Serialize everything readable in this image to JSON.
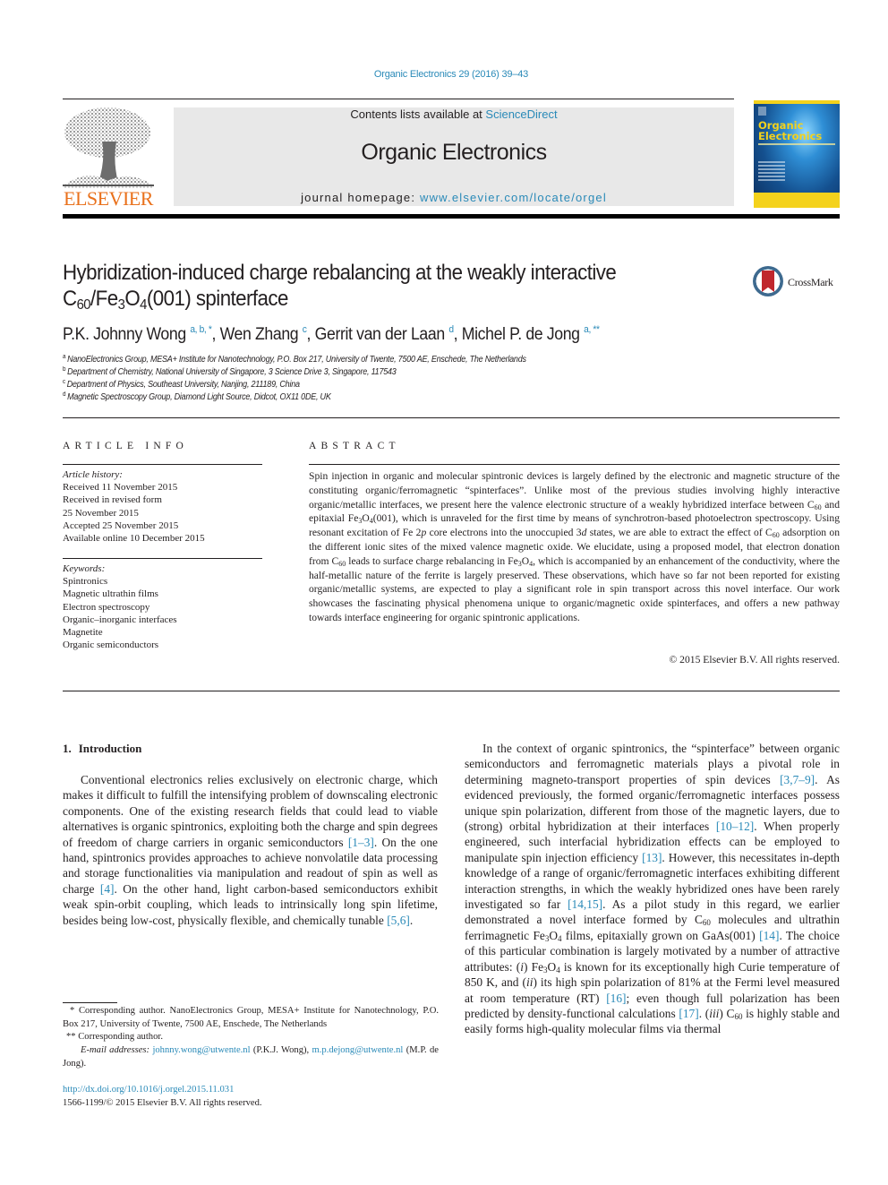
{
  "header": {
    "journal_citation": "Organic Electronics 29 (2016) 39–43",
    "contents_prefix": "Contents lists available at ",
    "contents_link": "ScienceDirect",
    "journal_name": "Organic Electronics",
    "homepage_prefix": "journal homepage: ",
    "homepage_link": "www.elsevier.com/locate/orgel",
    "publisher_logo_text": "ELSEVIER",
    "cover_title_line1": "Organic",
    "cover_title_line2": "Electronics",
    "crossmark_label": "CrossMark",
    "colors": {
      "link": "#2a8ab8",
      "elsevier_orange": "#e9711c",
      "banner_grey": "#e8e8e8",
      "cover_yellow": "#f4d21c"
    }
  },
  "article": {
    "title_line1": "Hybridization-induced charge rebalancing at the weakly interactive",
    "title_line2_parts": {
      "c": "C",
      "c_sub": "60",
      "slash_fe": "/Fe",
      "fe_sub": "3",
      "o": "O",
      "o_sub": "4",
      "rest": "(001) spinterface"
    },
    "authors": [
      {
        "name": "P.K. Johnny Wong",
        "marks": "a, b, *"
      },
      {
        "name": "Wen Zhang",
        "marks": "c"
      },
      {
        "name": "Gerrit van der Laan",
        "marks": "d"
      },
      {
        "name": "Michel P. de Jong",
        "marks": "a, **"
      }
    ],
    "affiliations": [
      {
        "mark": "a",
        "text": "NanoElectronics Group, MESA+ Institute for Nanotechnology, P.O. Box 217, University of Twente, 7500 AE, Enschede, The Netherlands"
      },
      {
        "mark": "b",
        "text": "Department of Chemistry, National University of Singapore, 3 Science Drive 3, Singapore, 117543"
      },
      {
        "mark": "c",
        "text": "Department of Physics, Southeast University, Nanjing, 211189, China"
      },
      {
        "mark": "d",
        "text": "Magnetic Spectroscopy Group, Diamond Light Source, Didcot, OX11 0DE, UK"
      }
    ]
  },
  "article_info": {
    "heading": "ARTICLE INFO",
    "history_label": "Article history:",
    "history": [
      "Received 11 November 2015",
      "Received in revised form",
      "25 November 2015",
      "Accepted 25 November 2015",
      "Available online 10 December 2015"
    ],
    "keywords_label": "Keywords:",
    "keywords": [
      "Spintronics",
      "Magnetic ultrathin films",
      "Electron spectroscopy",
      "Organic–inorganic interfaces",
      "Magnetite",
      "Organic semiconductors"
    ]
  },
  "abstract": {
    "heading": "ABSTRACT",
    "s1": "Spin injection in organic and molecular spintronic devices is largely defined by the electronic and magnetic structure of the constituting organic/ferromagnetic “spinterfaces”. Unlike most of the previous studies involving highly interactive organic/metallic interfaces, we present here the valence electronic structure of a weakly hybridized interface between C",
    "s1_sub": "60",
    "s2": " and epitaxial Fe",
    "s2_sub": "3",
    "s3": "O",
    "s3_sub": "4",
    "s4": "(001), which is unraveled for the first time by means of synchrotron-based photoelectron spectroscopy. Using resonant excitation of Fe 2",
    "s4_italic": "p",
    "s5": " core electrons into the unoccupied 3",
    "s5_italic": "d",
    "s6": " states, we are able to extract the effect of C",
    "s6_sub": "60",
    "s7": " adsorption on the different ionic sites of the mixed valence magnetic oxide. We elucidate, using a proposed model, that electron donation from C",
    "s7_sub": "60",
    "s8": " leads to surface charge rebalancing in Fe",
    "s8_sub": "3",
    "s9": "O",
    "s9_sub": "4",
    "s10": ", which is accompanied by an enhancement of the conductivity, where the half-metallic nature of the ferrite is largely preserved. These observations, which have so far not been reported for existing organic/metallic systems, are expected to play a significant role in spin transport across this novel interface. Our work showcases the fascinating physical phenomena unique to organic/magnetic oxide spinterfaces, and offers a new pathway towards interface engineering for organic spintronic applications.",
    "copyright": "© 2015 Elsevier B.V. All rights reserved."
  },
  "body": {
    "section_number": "1.",
    "section_title": "Introduction",
    "left_p1": {
      "t1": "Conventional electronics relies exclusively on electronic charge, which makes it difficult to fulfill the intensifying problem of downscaling electronic components. One of the existing research fields that could lead to viable alternatives is organic spintronics, exploiting both the charge and spin degrees of freedom of charge carriers in organic semiconductors ",
      "c1": "[1–3]",
      "t2": ". On the one hand, spintronics provides approaches to achieve nonvolatile data processing and storage functionalities via manipulation and readout of spin as well as charge ",
      "c2": "[4]",
      "t3": ". On the other hand, light carbon-based semiconductors exhibit weak spin-orbit coupling, which leads to intrinsically long spin lifetime, besides being low-cost, physically flexible, and chemically tunable ",
      "c3": "[5,6]",
      "t4": "."
    },
    "right_p1": {
      "t1": "In the context of organic spintronics, the “spinterface” between organic semiconductors and ferromagnetic materials plays a pivotal role in determining magneto-transport properties of spin devices ",
      "c1": "[3,7–9]",
      "t2": ". As evidenced previously, the formed organic/ferromagnetic interfaces possess unique spin polarization, different from those of the magnetic layers, due to (strong) orbital hybridization at their interfaces ",
      "c2": "[10–12]",
      "t3": ". When properly engineered, such interfacial hybridization effects can be employed to manipulate spin injection efficiency ",
      "c3": "[13]",
      "t4": ". However, this necessitates in-depth knowledge of a range of organic/ferromagnetic interfaces exhibiting different interaction strengths, in which the weakly hybridized ones have been rarely investigated so far ",
      "c4": "[14,15]",
      "t5": ". As a pilot study in this regard, we earlier demonstrated a novel interface formed by C",
      "t5_sub": "60",
      "t6": " molecules and ultrathin ferrimagnetic Fe",
      "t6_sub": "3",
      "t7": "O",
      "t7_sub": "4",
      "t8": " films, epitaxially grown on GaAs(001) ",
      "c5": "[14]",
      "t9": ". The choice of this particular combination is largely motivated by a number of attractive attributes: (",
      "i1": "i",
      "t10": ") Fe",
      "t10_sub": "3",
      "t11": "O",
      "t11_sub": "4",
      "t12": " is known for its exceptionally high Curie temperature of 850 K, and (",
      "i2": "ii",
      "t13": ") its high spin polarization of 81% at the Fermi level measured at room temperature (RT) ",
      "c6": "[16]",
      "t14": "; even though full polarization has been predicted by density-functional calculations ",
      "c7": "[17]",
      "t15": ". (",
      "i3": "iii",
      "t16": ") C",
      "t16_sub": "60",
      "t17": " is highly stable and easily forms high-quality molecular films via thermal"
    }
  },
  "footnotes": {
    "star1": "* Corresponding author. NanoElectronics Group, MESA+ Institute for Nanotechnology, P.O. Box 217, University of Twente, 7500 AE, Enschede, The Netherlands",
    "star2": "** Corresponding author.",
    "email_label": "E-mail addresses:",
    "email1": "johnny.wong@utwente.nl",
    "email1_owner": " (P.K.J. Wong), ",
    "email2": "m.p.dejong@utwente.nl",
    "email2_owner": " (M.P. de Jong).",
    "doi": "http://dx.doi.org/10.1016/j.orgel.2015.11.031",
    "issn": "1566-1199/© 2015 Elsevier B.V. All rights reserved."
  }
}
